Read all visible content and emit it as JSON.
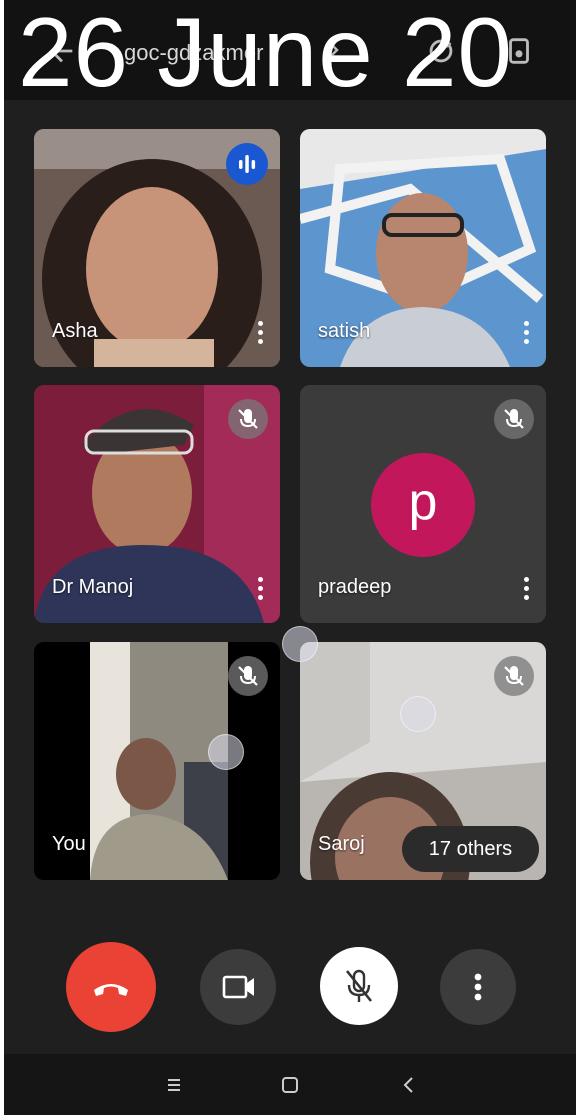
{
  "overlay": {
    "date_text": "26 June 20"
  },
  "meeting": {
    "code": "goc-gdzakmer"
  },
  "participants": [
    {
      "name": "Asha",
      "state": "speaking"
    },
    {
      "name": "satish",
      "state": "unmuted"
    },
    {
      "name": "Dr Manoj",
      "state": "muted"
    },
    {
      "name": "pradeep",
      "state": "muted",
      "avatar_letter": "p",
      "avatar_color": "#c2185b"
    },
    {
      "name": "You",
      "state": "muted"
    },
    {
      "name": "Saroj",
      "state": "muted"
    }
  ],
  "others_chip": {
    "label": "17 others"
  },
  "controls": {
    "end_call_color": "#ea4335",
    "camera": "camera-icon",
    "mic": "mic-off-icon",
    "more": "more-vert-icon"
  },
  "colors": {
    "background": "#1f1f1f",
    "speaking_badge": "#1a58d1",
    "end_call": "#ea4335"
  }
}
